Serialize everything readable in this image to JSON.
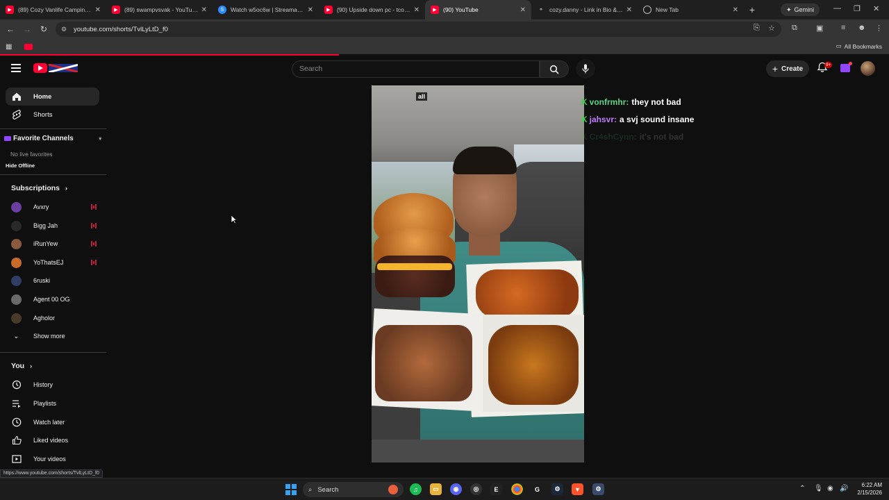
{
  "browser": {
    "tabs": [
      {
        "label": "(89) Cozy Vanlife Camping du",
        "icon": "youtube-icon",
        "active": false
      },
      {
        "label": "(89) swampvsvak - YouTube",
        "icon": "youtube-icon",
        "active": false
      },
      {
        "label": "Watch w5oc6w | Streamable",
        "icon": "streamable-icon",
        "active": false
      },
      {
        "label": "(90) Upside down pc - tcoma",
        "icon": "youtube-icon",
        "active": false
      },
      {
        "label": "(90) YouTube",
        "icon": "youtube-icon",
        "active": true
      },
      {
        "label": "cozy.danny - Link in Bio & Cr",
        "icon": "link-icon",
        "active": false
      },
      {
        "label": "New Tab",
        "icon": "globe-icon",
        "active": false
      }
    ],
    "gemini_label": "Gemini",
    "url": "youtube.com/shorts/TvlLyLtD_f0",
    "all_bookmarks": "All Bookmarks",
    "status_url": "https://www.youtube.com/shorts/TvlLyLtD_f0"
  },
  "youtube": {
    "search_placeholder": "Search",
    "create_label": "Create",
    "notification_badge": "9+",
    "sidebar": {
      "main": [
        {
          "label": "Home",
          "icon": "home-icon",
          "active": true
        },
        {
          "label": "Shorts",
          "icon": "shorts-icon",
          "active": false
        }
      ],
      "favorite_channels_title": "Favorite Channels",
      "no_live_favorites": "No live favorites",
      "hide_offline": "Hide Offline",
      "subscriptions_title": "Subscriptions",
      "subscriptions": [
        {
          "name": "Avxry",
          "live": true,
          "color": "#6b3fa0"
        },
        {
          "name": "Bigg Jah",
          "live": true,
          "color": "#2a2a2a"
        },
        {
          "name": "iRunYew",
          "live": true,
          "color": "#8a5a3e"
        },
        {
          "name": "YoThatsEJ",
          "live": true,
          "color": "#c96a2a"
        },
        {
          "name": "6ruski",
          "live": false,
          "color": "#2e3f63"
        },
        {
          "name": "Agent 00 OG",
          "live": false,
          "color": "#6a6a6a"
        },
        {
          "name": "Agholor",
          "live": false,
          "color": "#4a3a2a"
        }
      ],
      "show_more": "Show more",
      "you_title": "You",
      "you_items": [
        {
          "label": "History",
          "icon": "history-icon"
        },
        {
          "label": "Playlists",
          "icon": "playlists-icon"
        },
        {
          "label": "Watch later",
          "icon": "watch-later-icon"
        },
        {
          "label": "Liked videos",
          "icon": "liked-videos-icon"
        },
        {
          "label": "Your videos",
          "icon": "your-videos-icon"
        }
      ]
    },
    "video_overlay_tag": "all",
    "chat": [
      {
        "user": "vonfrmhr:",
        "message": "they not bad",
        "user_color": "#58d68d"
      },
      {
        "user": "jahsvr:",
        "message": "a svj sound insane",
        "user_color": "#c07bff"
      },
      {
        "user": "Cr4shCynn:",
        "message": "it's not bad",
        "user_color": "#58d68d"
      }
    ]
  },
  "taskbar": {
    "search_label": "Search",
    "time": "6:22 AM",
    "date": "2/15/2026"
  }
}
